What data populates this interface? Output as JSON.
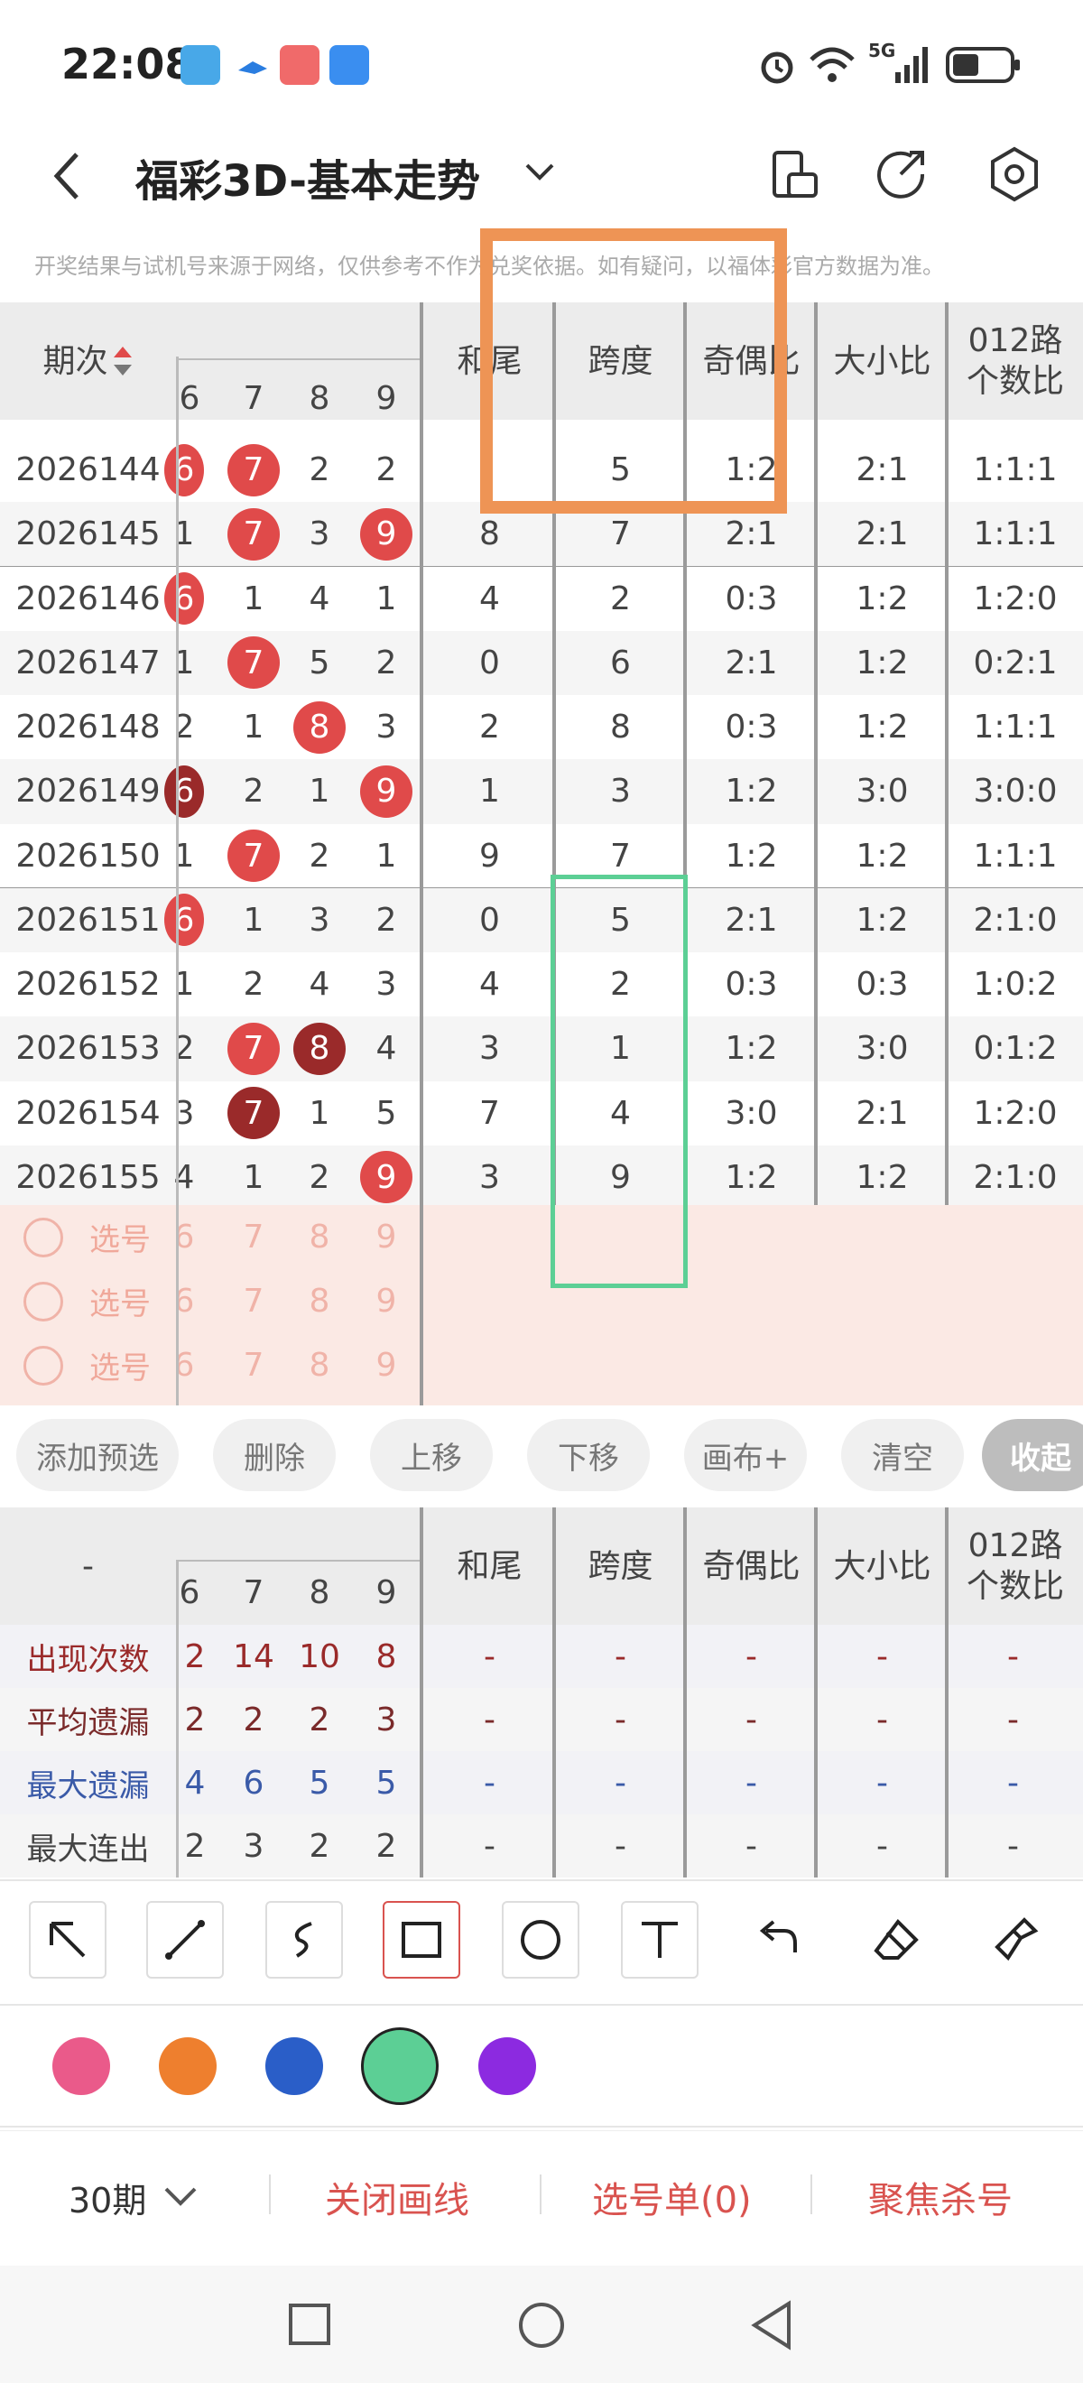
{
  "status_bar": {
    "time": "22:08",
    "net": "5G"
  },
  "header": {
    "title": "福彩3D-基本走势"
  },
  "notice": "开奖结果与试机号来源于网络，仅供参考不作为兑奖依据。如有疑问，以福体彩官方数据为准。",
  "table": {
    "headers": {
      "period": "期次",
      "digits": [
        "6",
        "7",
        "8",
        "9"
      ],
      "hewei": "和尾",
      "kuadu": "跨度",
      "jiou": "奇偶比",
      "daxiao": "大小比",
      "lu012_line1": "012路",
      "lu012_line2": "个数比"
    },
    "rows": [
      {
        "period": "2026144",
        "d6": "6",
        "d7": "7",
        "d8": "2",
        "d9": "2",
        "hewei": "",
        "kuadu": "5",
        "jiou": "1:2",
        "daxiao": "2:1",
        "lu": "1:1:1"
      },
      {
        "period": "2026145",
        "d6": "1",
        "d7": "7",
        "d8": "3",
        "d9": "9",
        "hewei": "8",
        "kuadu": "7",
        "jiou": "2:1",
        "daxiao": "2:1",
        "lu": "1:1:1"
      },
      {
        "period": "2026146",
        "d6": "6",
        "d7": "1",
        "d8": "4",
        "d9": "1",
        "hewei": "4",
        "kuadu": "2",
        "jiou": "0:3",
        "daxiao": "1:2",
        "lu": "1:2:0"
      },
      {
        "period": "2026147",
        "d6": "1",
        "d7": "7",
        "d8": "5",
        "d9": "2",
        "hewei": "0",
        "kuadu": "6",
        "jiou": "2:1",
        "daxiao": "1:2",
        "lu": "0:2:1"
      },
      {
        "period": "2026148",
        "d6": "2",
        "d7": "1",
        "d8": "8",
        "d9": "3",
        "hewei": "2",
        "kuadu": "8",
        "jiou": "0:3",
        "daxiao": "1:2",
        "lu": "1:1:1"
      },
      {
        "period": "2026149",
        "d6": "6",
        "d7": "2",
        "d8": "1",
        "d9": "9",
        "hewei": "1",
        "kuadu": "3",
        "jiou": "1:2",
        "daxiao": "3:0",
        "lu": "3:0:0"
      },
      {
        "period": "2026150",
        "d6": "1",
        "d7": "7",
        "d8": "2",
        "d9": "1",
        "hewei": "9",
        "kuadu": "7",
        "jiou": "1:2",
        "daxiao": "1:2",
        "lu": "1:1:1"
      },
      {
        "period": "2026151",
        "d6": "6",
        "d7": "1",
        "d8": "3",
        "d9": "2",
        "hewei": "0",
        "kuadu": "5",
        "jiou": "2:1",
        "daxiao": "1:2",
        "lu": "2:1:0"
      },
      {
        "period": "2026152",
        "d6": "1",
        "d7": "2",
        "d8": "4",
        "d9": "3",
        "hewei": "4",
        "kuadu": "2",
        "jiou": "0:3",
        "daxiao": "0:3",
        "lu": "1:0:2"
      },
      {
        "period": "2026153",
        "d6": "2",
        "d7": "7",
        "d8": "8",
        "d9": "4",
        "hewei": "3",
        "kuadu": "1",
        "jiou": "1:2",
        "daxiao": "3:0",
        "lu": "0:1:2"
      },
      {
        "period": "2026154",
        "d6": "3",
        "d7": "7",
        "d8": "1",
        "d9": "5",
        "hewei": "7",
        "kuadu": "4",
        "jiou": "3:0",
        "daxiao": "2:1",
        "lu": "1:2:0"
      },
      {
        "period": "2026155",
        "d6": "4",
        "d7": "1",
        "d8": "2",
        "d9": "9",
        "hewei": "3",
        "kuadu": "9",
        "jiou": "1:2",
        "daxiao": "1:2",
        "lu": "2:1:0"
      }
    ],
    "ball_styles": [
      {
        "d6": "red",
        "d7": "red",
        "d9": ""
      },
      {
        "d7": "red",
        "d9": "red"
      },
      {
        "d6": "red"
      },
      {
        "d7": "red"
      },
      {
        "d8": "red"
      },
      {
        "d6": "dark",
        "d9": "red"
      },
      {
        "d7": "red"
      },
      {
        "d6": "red"
      },
      {},
      {
        "d7": "red",
        "d8": "dark"
      },
      {
        "d7": "dark"
      },
      {
        "d9": "red"
      }
    ],
    "pick_label": "选号"
  },
  "actions": {
    "add": "添加预选",
    "delete": "删除",
    "up": "上移",
    "down": "下移",
    "canvas": "画布+",
    "clear": "清空",
    "collapse": "收起"
  },
  "stats": {
    "dash": "-",
    "rows": [
      {
        "label": "出现次数",
        "color": "#9a2a2a",
        "vals": [
          "2",
          "14",
          "10",
          "8"
        ]
      },
      {
        "label": "平均遗漏",
        "color": "#7a2a2a",
        "vals": [
          "2",
          "2",
          "2",
          "3"
        ]
      },
      {
        "label": "最大遗漏",
        "color": "#3a5aa8",
        "vals": [
          "4",
          "6",
          "5",
          "5"
        ]
      },
      {
        "label": "最大连出",
        "color": "#444444",
        "vals": [
          "2",
          "3",
          "2",
          "2"
        ]
      }
    ]
  },
  "draw_colors": [
    "#ea5a8a",
    "#ee7f2e",
    "#2a5ec8",
    "#5ccf95",
    "#8c2ae0"
  ],
  "bottom": {
    "period": "30期",
    "close_line": "关闭画线",
    "pick_list": "选号单(0)",
    "focus": "聚焦杀号"
  }
}
